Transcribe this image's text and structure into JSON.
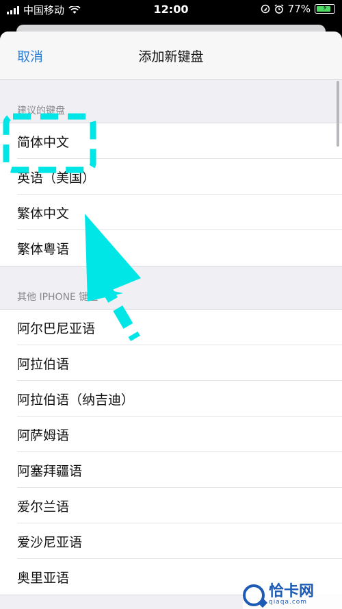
{
  "status_bar": {
    "carrier": "中国移动",
    "time": "12:00",
    "battery": "77%",
    "icons": [
      "signal-icon",
      "wifi-icon",
      "location-icon",
      "alarm-icon",
      "battery-charging-icon"
    ]
  },
  "nav": {
    "cancel_label": "取消",
    "title": "添加新键盘"
  },
  "sections": {
    "suggested": {
      "header": "建议的键盘",
      "items": [
        "简体中文",
        "英语（美国）",
        "繁体中文",
        "繁体粤语"
      ]
    },
    "other": {
      "header": "其他 IPHONE 键盘",
      "items": [
        "阿尔巴尼亚语",
        "阿拉伯语",
        "阿拉伯语（纳吉迪）",
        "阿萨姆语",
        "阿塞拜疆语",
        "爱尔兰语",
        "爱沙尼亚语",
        "奥里亚语"
      ]
    }
  },
  "annotation": {
    "color": "#00e6e6"
  },
  "watermark": {
    "name": "恰卡网",
    "domain": "qiaqa.com"
  },
  "colors": {
    "link": "#2f7fd7",
    "section_text": "#8a8a8e"
  }
}
